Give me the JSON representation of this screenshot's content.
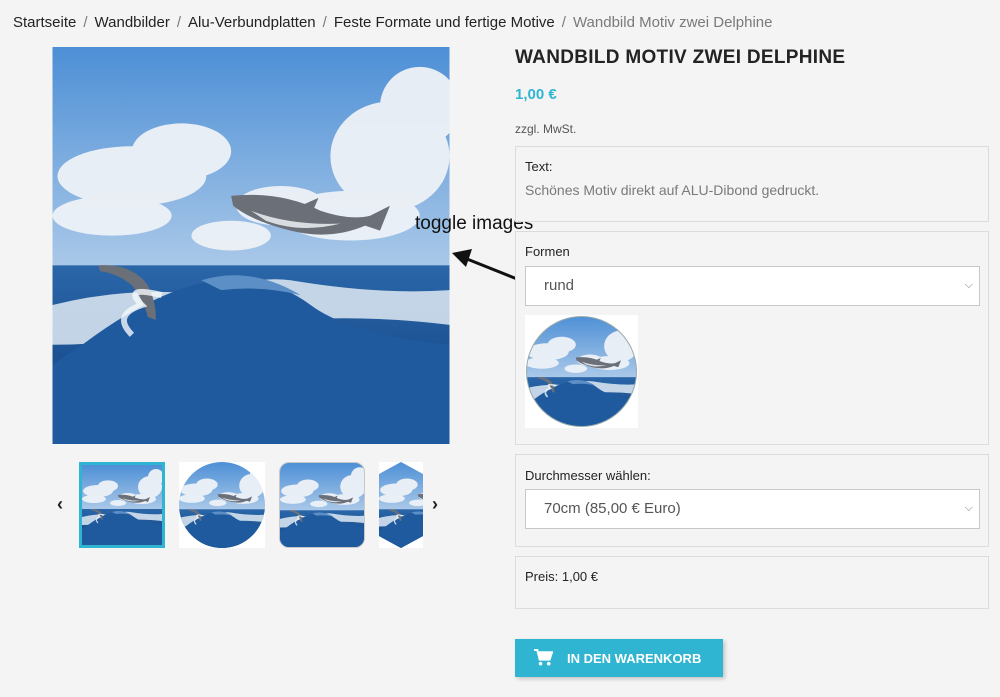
{
  "breadcrumb": {
    "items": [
      "Startseite",
      "Wandbilder",
      "Alu-Verbundplatten",
      "Feste Formate und fertige Motive"
    ],
    "current": "Wandbild Motiv zwei Delphine",
    "separator": "/"
  },
  "product": {
    "title": "WANDBILD MOTIV ZWEI DELPHINE",
    "price": "1,00 €",
    "tax_note": "zzgl. MwSt."
  },
  "text_box": {
    "label": "Text:",
    "value": "Schönes Motiv direkt auf ALU-Dibond gedruckt."
  },
  "formen": {
    "label": "Formen",
    "selected": "rund"
  },
  "durchmesser": {
    "label": "Durchmesser wählen:",
    "selected": "70cm (85,00 € Euro)"
  },
  "preis": {
    "label": "Preis:",
    "value": "1,00 €"
  },
  "cart": {
    "label": "IN DEN WARENKORB"
  },
  "annotation": {
    "text": "toggle images"
  },
  "gallery": {
    "prev_icon": "chevron-left-icon",
    "next_icon": "chevron-right-icon",
    "thumbs": [
      "square",
      "round",
      "rounded-square",
      "hexagon"
    ]
  },
  "colors": {
    "accent": "#2fb5d2",
    "background": "#f4f4f4",
    "text": "#232323"
  }
}
